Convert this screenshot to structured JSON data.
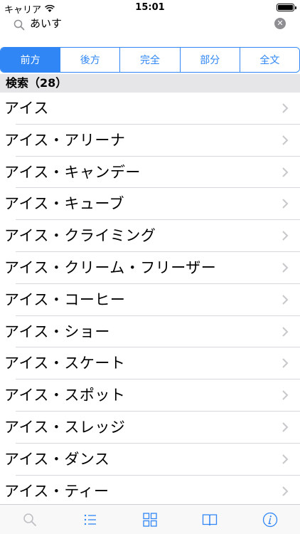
{
  "status_bar": {
    "carrier": "キャリア",
    "time": "15:01"
  },
  "search": {
    "value": "あいす"
  },
  "segments": [
    {
      "label": "前方",
      "selected": true
    },
    {
      "label": "後方",
      "selected": false
    },
    {
      "label": "完全",
      "selected": false
    },
    {
      "label": "部分",
      "selected": false
    },
    {
      "label": "全文",
      "selected": false
    }
  ],
  "results": {
    "header": "検索（28）",
    "items": [
      "アイス",
      "アイス・アリーナ",
      "アイス・キャンデー",
      "アイス・キューブ",
      "アイス・クライミング",
      "アイス・クリーム・フリーザー",
      "アイス・コーヒー",
      "アイス・ショー",
      "アイス・スケート",
      "アイス・スポット",
      "アイス・スレッジ",
      "アイス・ダンス",
      "アイス・ティー"
    ]
  },
  "tab_bar": {
    "tabs": [
      {
        "icon": "search-icon",
        "active": false
      },
      {
        "icon": "list-icon",
        "active": false
      },
      {
        "icon": "grid-icon",
        "active": false
      },
      {
        "icon": "book-icon",
        "active": false
      },
      {
        "icon": "info-icon",
        "active": false
      }
    ]
  },
  "colors": {
    "accent": "#2f86f4",
    "section_header_bg": "#e6e6e8",
    "inactive_icon": "#bfbfc4"
  }
}
